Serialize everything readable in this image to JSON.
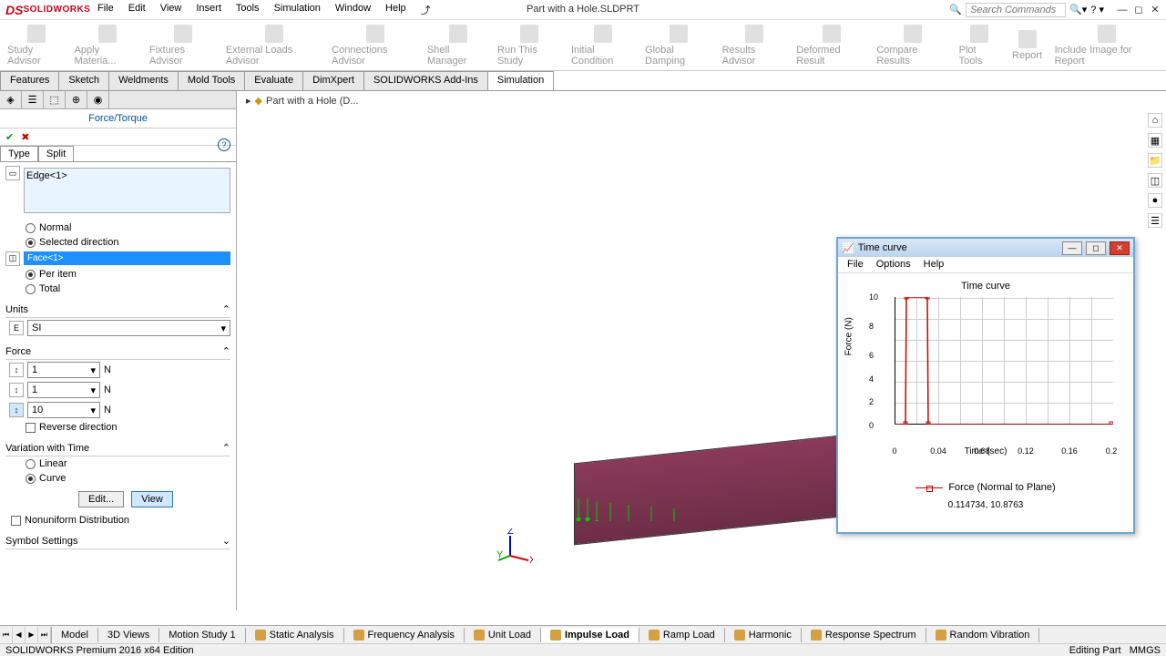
{
  "app": {
    "name": "SOLIDWORKS",
    "doc_title": "Part with a Hole.SLDPRT",
    "search_placeholder": "Search Commands"
  },
  "menu": [
    "File",
    "Edit",
    "View",
    "Insert",
    "Tools",
    "Simulation",
    "Window",
    "Help"
  ],
  "ribbon": [
    "Study Advisor",
    "Apply Materia...",
    "Fixtures Advisor",
    "External Loads Advisor",
    "Connections Advisor",
    "Shell Manager",
    "Run This Study",
    "Initial Condition",
    "Global Damping",
    "Results Advisor",
    "Deformed Result",
    "Compare Results",
    "Plot Tools",
    "Report",
    "Include Image for Report"
  ],
  "tabs": [
    "Features",
    "Sketch",
    "Weldments",
    "Mold Tools",
    "Evaluate",
    "DimXpert",
    "SOLIDWORKS Add-Ins",
    "Simulation"
  ],
  "active_tab": "Simulation",
  "breadcrumb": "Part with a Hole  (D...",
  "panel": {
    "title": "Force/Torque",
    "sub_tabs": [
      "Type",
      "Split"
    ],
    "selection_item": "Edge<1>",
    "normal": "Normal",
    "selected_dir": "Selected direction",
    "face_item": "Face<1>",
    "per_item": "Per item",
    "total": "Total",
    "units_header": "Units",
    "units_value": "SI",
    "force_header": "Force",
    "force_1": "1",
    "force_1_unit": "N",
    "force_2": "1",
    "force_2_unit": "N",
    "force_3": "10",
    "force_3_unit": "N",
    "reverse": "Reverse direction",
    "variation_header": "Variation with Time",
    "linear": "Linear",
    "curve": "Curve",
    "edit_btn": "Edit...",
    "view_btn": "View",
    "nonuniform": "Nonuniform Distribution",
    "symbol_header": "Symbol Settings"
  },
  "time_curve": {
    "window_title": "Time curve",
    "menu": [
      "File",
      "Options",
      "Help"
    ],
    "chart_title": "Time curve",
    "y_label": "Force (N)",
    "x_label": "Time (sec)",
    "legend": "Force (Normal to Plane)",
    "cursor": "0.114734, 10.8763"
  },
  "chart_data": {
    "type": "line",
    "title": "Time curve",
    "xlabel": "Time (sec)",
    "ylabel": "Force (N)",
    "xlim": [
      0,
      0.2
    ],
    "ylim": [
      0,
      10
    ],
    "x_ticks": [
      0.0,
      0.04,
      0.08,
      0.12,
      0.16,
      0.2
    ],
    "y_ticks": [
      0.0,
      2.0,
      4.0,
      6.0,
      8.0,
      10.0
    ],
    "series": [
      {
        "name": "Force (Normal to Plane)",
        "x": [
          0.0,
          0.01,
          0.011,
          0.03,
          0.031,
          0.2
        ],
        "y": [
          0,
          0,
          10,
          10,
          0,
          0
        ]
      }
    ]
  },
  "bottom_tabs": [
    "Model",
    "3D Views",
    "Motion Study 1",
    "Static Analysis",
    "Frequency Analysis",
    "Unit Load",
    "Impulse Load",
    "Ramp Load",
    "Harmonic",
    "Response Spectrum",
    "Random Vibration"
  ],
  "active_bottom": "Impulse Load",
  "status": {
    "left": "SOLIDWORKS Premium 2016 x64 Edition",
    "right": "Editing Part",
    "units": "MMGS"
  }
}
